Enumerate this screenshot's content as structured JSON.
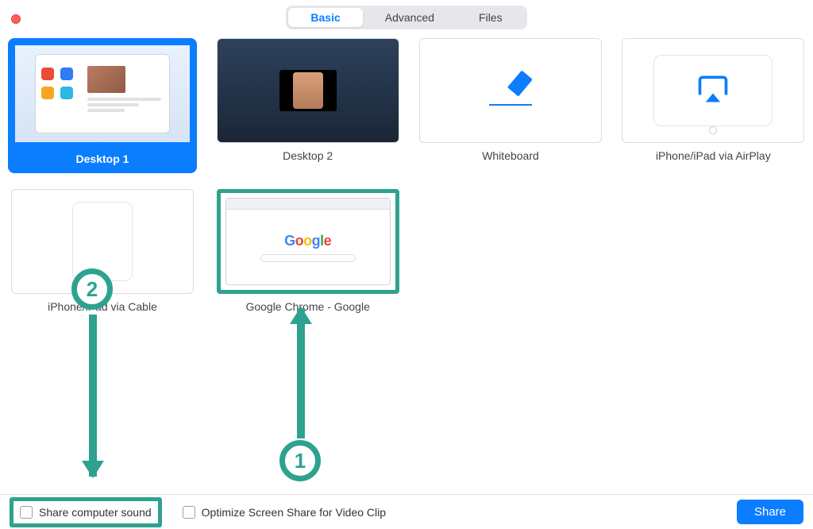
{
  "tabs": {
    "basic": "Basic",
    "advanced": "Advanced",
    "files": "Files",
    "active": "basic"
  },
  "tiles": {
    "desktop1": "Desktop 1",
    "desktop2": "Desktop 2",
    "whiteboard": "Whiteboard",
    "airplay": "iPhone/iPad via AirPlay",
    "cable": "iPhone/iPad via Cable",
    "chrome": "Google Chrome - Google"
  },
  "bottom": {
    "share_sound": "Share computer sound",
    "optimize": "Optimize Screen Share for Video Clip",
    "share_button": "Share"
  },
  "annotations": {
    "step1": "1",
    "step2": "2"
  },
  "colors": {
    "accent": "#0b7dff",
    "annotation": "#2ea28f"
  }
}
